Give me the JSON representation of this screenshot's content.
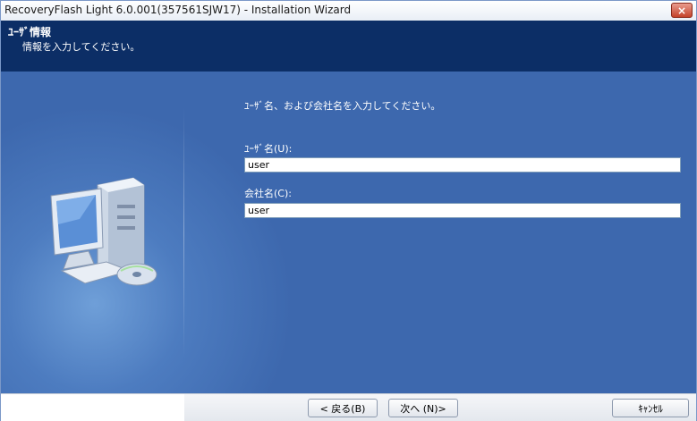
{
  "window": {
    "title": "RecoveryFlash Light 6.0.001(357561SJW17) - Installation Wizard",
    "close_label": "×"
  },
  "header": {
    "title": "ﾕｰｻﾞ情報",
    "subtitle": "情報を入力してください。"
  },
  "main": {
    "instruction": "ﾕｰｻﾞ名、および会社名を入力してください。",
    "user_label": "ﾕｰｻﾞ名(U):",
    "user_value": "user",
    "company_label": "会社名(C):",
    "company_value": "user",
    "illustration_icon": "computer-icon"
  },
  "footer": {
    "back_label": "< 戻る(B)",
    "next_label": "次へ (N)>",
    "cancel_label": "ｷｬﾝｾﾙ"
  },
  "colors": {
    "header_bg": "#0c2e66",
    "body_bg": "#3f6aaf",
    "close_button": "#c4422a"
  }
}
